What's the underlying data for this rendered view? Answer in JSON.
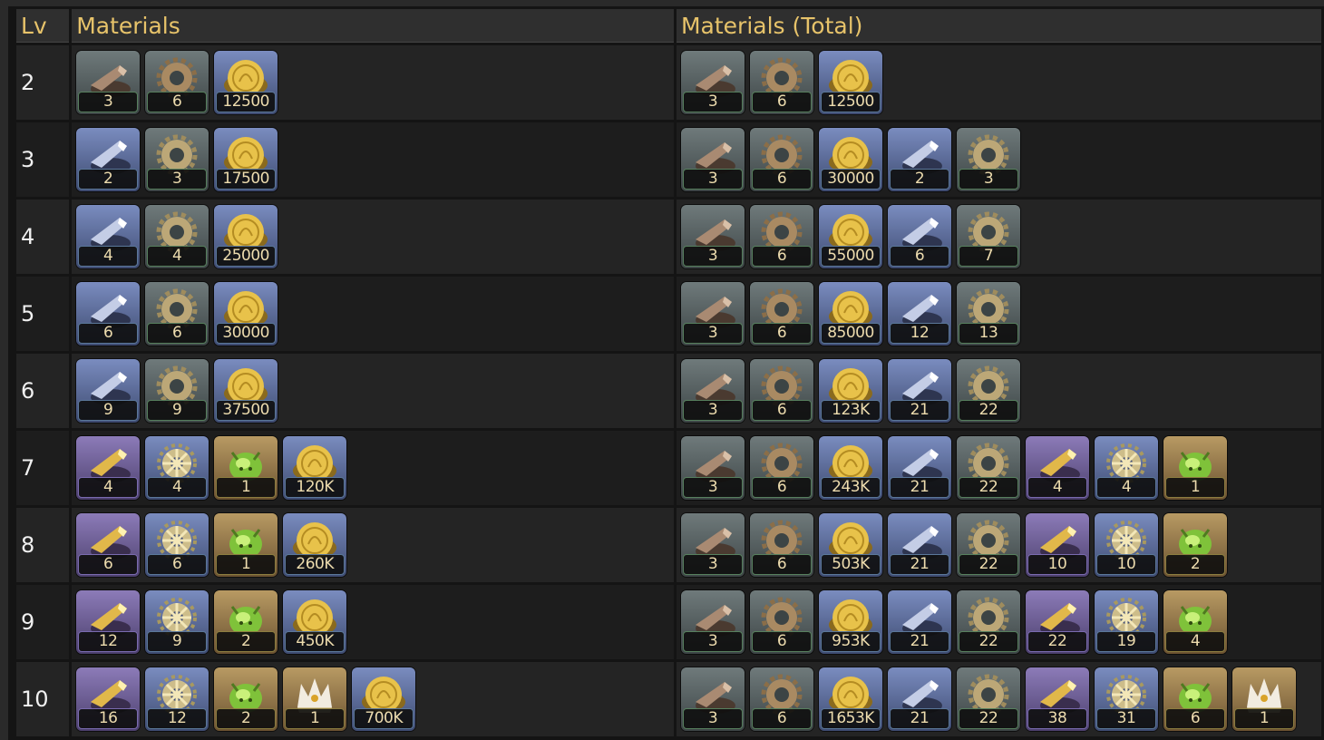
{
  "headers": {
    "lv": "Lv",
    "materials": "Materials",
    "total": "Materials (Total)"
  },
  "colors": {
    "header_text": "#e7c36a",
    "row_odd": "#242424",
    "row_even": "#1d1d1d"
  },
  "rows": [
    {
      "lv": "2",
      "materials": [
        {
          "icon": "bronze-ore-icon",
          "qty": "3"
        },
        {
          "icon": "bronze-gear-icon",
          "qty": "6"
        },
        {
          "icon": "gold-coin-icon",
          "qty": "12500"
        }
      ],
      "total": [
        {
          "icon": "bronze-ore-icon",
          "qty": "3"
        },
        {
          "icon": "bronze-gear-icon",
          "qty": "6"
        },
        {
          "icon": "gold-coin-icon",
          "qty": "12500"
        }
      ]
    },
    {
      "lv": "3",
      "materials": [
        {
          "icon": "silver-ore-icon",
          "qty": "2"
        },
        {
          "icon": "silver-gear-icon",
          "qty": "3"
        },
        {
          "icon": "gold-coin-icon",
          "qty": "17500"
        }
      ],
      "total": [
        {
          "icon": "bronze-ore-icon",
          "qty": "3"
        },
        {
          "icon": "bronze-gear-icon",
          "qty": "6"
        },
        {
          "icon": "gold-coin-icon",
          "qty": "30000"
        },
        {
          "icon": "silver-ore-icon",
          "qty": "2"
        },
        {
          "icon": "silver-gear-icon",
          "qty": "3"
        }
      ]
    },
    {
      "lv": "4",
      "materials": [
        {
          "icon": "silver-ore-icon",
          "qty": "4"
        },
        {
          "icon": "silver-gear-icon",
          "qty": "4"
        },
        {
          "icon": "gold-coin-icon",
          "qty": "25000"
        }
      ],
      "total": [
        {
          "icon": "bronze-ore-icon",
          "qty": "3"
        },
        {
          "icon": "bronze-gear-icon",
          "qty": "6"
        },
        {
          "icon": "gold-coin-icon",
          "qty": "55000"
        },
        {
          "icon": "silver-ore-icon",
          "qty": "6"
        },
        {
          "icon": "silver-gear-icon",
          "qty": "7"
        }
      ]
    },
    {
      "lv": "5",
      "materials": [
        {
          "icon": "silver-ore-icon",
          "qty": "6"
        },
        {
          "icon": "silver-gear-icon",
          "qty": "6"
        },
        {
          "icon": "gold-coin-icon",
          "qty": "30000"
        }
      ],
      "total": [
        {
          "icon": "bronze-ore-icon",
          "qty": "3"
        },
        {
          "icon": "bronze-gear-icon",
          "qty": "6"
        },
        {
          "icon": "gold-coin-icon",
          "qty": "85000"
        },
        {
          "icon": "silver-ore-icon",
          "qty": "12"
        },
        {
          "icon": "silver-gear-icon",
          "qty": "13"
        }
      ]
    },
    {
      "lv": "6",
      "materials": [
        {
          "icon": "silver-ore-icon",
          "qty": "9"
        },
        {
          "icon": "silver-gear-icon",
          "qty": "9"
        },
        {
          "icon": "gold-coin-icon",
          "qty": "37500"
        }
      ],
      "total": [
        {
          "icon": "bronze-ore-icon",
          "qty": "3"
        },
        {
          "icon": "bronze-gear-icon",
          "qty": "6"
        },
        {
          "icon": "gold-coin-icon",
          "qty": "123K"
        },
        {
          "icon": "silver-ore-icon",
          "qty": "21"
        },
        {
          "icon": "silver-gear-icon",
          "qty": "22"
        }
      ]
    },
    {
      "lv": "7",
      "materials": [
        {
          "icon": "gold-ore-icon",
          "qty": "4"
        },
        {
          "icon": "ornate-gear-icon",
          "qty": "4"
        },
        {
          "icon": "green-crystal-icon",
          "qty": "1"
        },
        {
          "icon": "gold-coin-icon",
          "qty": "120K"
        }
      ],
      "total": [
        {
          "icon": "bronze-ore-icon",
          "qty": "3"
        },
        {
          "icon": "bronze-gear-icon",
          "qty": "6"
        },
        {
          "icon": "gold-coin-icon",
          "qty": "243K"
        },
        {
          "icon": "silver-ore-icon",
          "qty": "21"
        },
        {
          "icon": "silver-gear-icon",
          "qty": "22"
        },
        {
          "icon": "gold-ore-icon",
          "qty": "4"
        },
        {
          "icon": "ornate-gear-icon",
          "qty": "4"
        },
        {
          "icon": "green-crystal-icon",
          "qty": "1"
        }
      ]
    },
    {
      "lv": "8",
      "materials": [
        {
          "icon": "gold-ore-icon",
          "qty": "6"
        },
        {
          "icon": "ornate-gear-icon",
          "qty": "6"
        },
        {
          "icon": "green-crystal-icon",
          "qty": "1"
        },
        {
          "icon": "gold-coin-icon",
          "qty": "260K"
        }
      ],
      "total": [
        {
          "icon": "bronze-ore-icon",
          "qty": "3"
        },
        {
          "icon": "bronze-gear-icon",
          "qty": "6"
        },
        {
          "icon": "gold-coin-icon",
          "qty": "503K"
        },
        {
          "icon": "silver-ore-icon",
          "qty": "21"
        },
        {
          "icon": "silver-gear-icon",
          "qty": "22"
        },
        {
          "icon": "gold-ore-icon",
          "qty": "10"
        },
        {
          "icon": "ornate-gear-icon",
          "qty": "10"
        },
        {
          "icon": "green-crystal-icon",
          "qty": "2"
        }
      ]
    },
    {
      "lv": "9",
      "materials": [
        {
          "icon": "gold-ore-icon",
          "qty": "12"
        },
        {
          "icon": "ornate-gear-icon",
          "qty": "9"
        },
        {
          "icon": "green-crystal-icon",
          "qty": "2"
        },
        {
          "icon": "gold-coin-icon",
          "qty": "450K"
        }
      ],
      "total": [
        {
          "icon": "bronze-ore-icon",
          "qty": "3"
        },
        {
          "icon": "bronze-gear-icon",
          "qty": "6"
        },
        {
          "icon": "gold-coin-icon",
          "qty": "953K"
        },
        {
          "icon": "silver-ore-icon",
          "qty": "21"
        },
        {
          "icon": "silver-gear-icon",
          "qty": "22"
        },
        {
          "icon": "gold-ore-icon",
          "qty": "22"
        },
        {
          "icon": "ornate-gear-icon",
          "qty": "19"
        },
        {
          "icon": "green-crystal-icon",
          "qty": "4"
        }
      ]
    },
    {
      "lv": "10",
      "materials": [
        {
          "icon": "gold-ore-icon",
          "qty": "16"
        },
        {
          "icon": "ornate-gear-icon",
          "qty": "12"
        },
        {
          "icon": "green-crystal-icon",
          "qty": "2"
        },
        {
          "icon": "crown-icon",
          "qty": "1"
        },
        {
          "icon": "gold-coin-icon",
          "qty": "700K"
        }
      ],
      "total": [
        {
          "icon": "bronze-ore-icon",
          "qty": "3"
        },
        {
          "icon": "bronze-gear-icon",
          "qty": "6"
        },
        {
          "icon": "gold-coin-icon",
          "qty": "1653K"
        },
        {
          "icon": "silver-ore-icon",
          "qty": "21"
        },
        {
          "icon": "silver-gear-icon",
          "qty": "22"
        },
        {
          "icon": "gold-ore-icon",
          "qty": "38"
        },
        {
          "icon": "ornate-gear-icon",
          "qty": "31"
        },
        {
          "icon": "green-crystal-icon",
          "qty": "6"
        },
        {
          "icon": "crown-icon",
          "qty": "1"
        }
      ]
    }
  ]
}
